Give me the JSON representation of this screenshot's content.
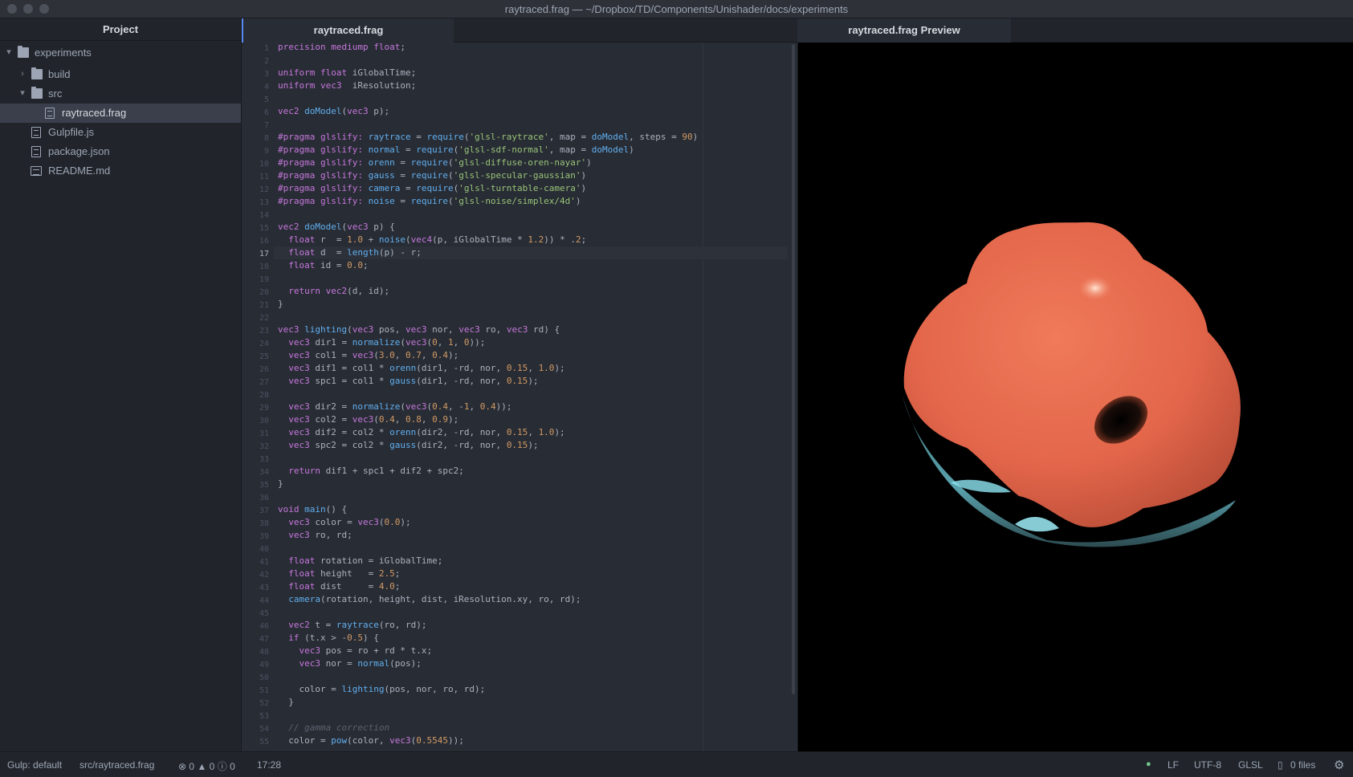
{
  "window": {
    "title": "raytraced.frag — ~/Dropbox/TD/Components/Unishader/docs/experiments"
  },
  "tree": {
    "header": "Project",
    "items": [
      {
        "label": "experiments",
        "type": "folder",
        "expanded": true,
        "icon": "folder-icon"
      },
      {
        "label": "build",
        "type": "folder",
        "expanded": false,
        "icon": "folder-icon"
      },
      {
        "label": "src",
        "type": "folder",
        "expanded": true,
        "icon": "folder-icon"
      },
      {
        "label": "raytraced.frag",
        "type": "file",
        "selected": true,
        "icon": "file-icon"
      },
      {
        "label": "Gulpfile.js",
        "type": "file",
        "icon": "file-icon"
      },
      {
        "label": "package.json",
        "type": "file",
        "icon": "file-icon"
      },
      {
        "label": "README.md",
        "type": "file",
        "icon": "book-icon"
      }
    ]
  },
  "tabs": [
    {
      "label": "raytraced.frag"
    },
    {
      "label": "raytraced.frag Preview"
    }
  ],
  "editor": {
    "cursor_line": 17,
    "lines": [
      "1",
      "2",
      "3",
      "4",
      "5",
      "6",
      "7",
      "8",
      "9",
      "10",
      "11",
      "12",
      "13",
      "14",
      "15",
      "16",
      "17",
      "18",
      "19",
      "20",
      "21",
      "22",
      "23",
      "24",
      "25",
      "26",
      "27",
      "28",
      "29",
      "30",
      "31",
      "32",
      "33",
      "34",
      "35",
      "36",
      "37",
      "38",
      "39",
      "40",
      "41",
      "42",
      "43",
      "44",
      "45",
      "46",
      "47",
      "48",
      "49",
      "50",
      "51",
      "52",
      "53",
      "54",
      "55"
    ],
    "code": [
      "precision mediump float;",
      "",
      "uniform float iGlobalTime;",
      "uniform vec3  iResolution;",
      "",
      "vec2 doModel(vec3 p);",
      "",
      "#pragma glslify: raytrace = require('glsl-raytrace', map = doModel, steps = 90)",
      "#pragma glslify: normal = require('glsl-sdf-normal', map = doModel)",
      "#pragma glslify: orenn = require('glsl-diffuse-oren-nayar')",
      "#pragma glslify: gauss = require('glsl-specular-gaussian')",
      "#pragma glslify: camera = require('glsl-turntable-camera')",
      "#pragma glslify: noise = require('glsl-noise/simplex/4d')",
      "",
      "vec2 doModel(vec3 p) {",
      "  float r  = 1.0 + noise(vec4(p, iGlobalTime * 1.2)) * .2;",
      "  float d  = length(p) - r;",
      "  float id = 0.0;",
      "",
      "  return vec2(d, id);",
      "}",
      "",
      "vec3 lighting(vec3 pos, vec3 nor, vec3 ro, vec3 rd) {",
      "  vec3 dir1 = normalize(vec3(0, 1, 0));",
      "  vec3 col1 = vec3(3.0, 0.7, 0.4);",
      "  vec3 dif1 = col1 * orenn(dir1, -rd, nor, 0.15, 1.0);",
      "  vec3 spc1 = col1 * gauss(dir1, -rd, nor, 0.15);",
      "",
      "  vec3 dir2 = normalize(vec3(0.4, -1, 0.4));",
      "  vec3 col2 = vec3(0.4, 0.8, 0.9);",
      "  vec3 dif2 = col2 * orenn(dir2, -rd, nor, 0.15, 1.0);",
      "  vec3 spc2 = col2 * gauss(dir2, -rd, nor, 0.15);",
      "",
      "  return dif1 + spc1 + dif2 + spc2;",
      "}",
      "",
      "void main() {",
      "  vec3 color = vec3(0.0);",
      "  vec3 ro, rd;",
      "",
      "  float rotation = iGlobalTime;",
      "  float height   = 2.5;",
      "  float dist     = 4.0;",
      "  camera(rotation, height, dist, iResolution.xy, ro, rd);",
      "",
      "  vec2 t = raytrace(ro, rd);",
      "  if (t.x > -0.5) {",
      "    vec3 pos = ro + rd * t.x;",
      "    vec3 nor = normal(pos);",
      "",
      "    color = lighting(pos, nor, ro, rd);",
      "  }",
      "",
      "  // gamma correction",
      "  color = pow(color, vec3(0.5545));"
    ]
  },
  "status": {
    "gulp": "Gulp: default",
    "path": "src/raytraced.frag",
    "errors": "0",
    "warnings": "0",
    "infos": "0",
    "cursor": "17:28",
    "line_ending": "LF",
    "encoding": "UTF-8",
    "grammar": "GLSL",
    "files": "0 files",
    "git_dot_color": "#73c990"
  },
  "colors": {
    "keyword": "#c678dd",
    "function": "#61afef",
    "string": "#98c379",
    "number": "#d19a66",
    "blob": "#e8694a"
  }
}
